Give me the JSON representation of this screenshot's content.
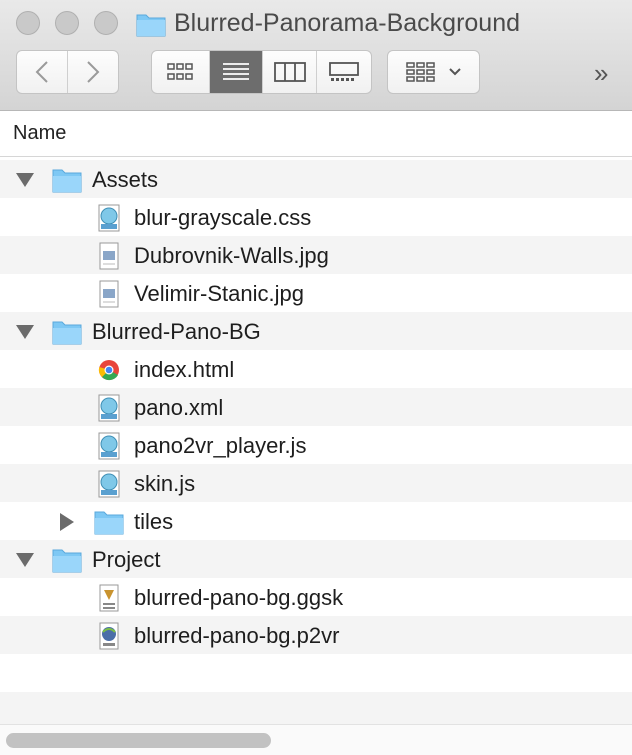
{
  "window": {
    "title": "Blurred-Panorama-Background"
  },
  "toolbar": {
    "back": "back",
    "forward": "forward",
    "overflow": "»"
  },
  "header": {
    "name_column": "Name"
  },
  "rows": [
    {
      "label": "Assets",
      "type": "folder",
      "expanded": true,
      "depth": 0
    },
    {
      "label": "blur-grayscale.css",
      "type": "text-file",
      "depth": 1
    },
    {
      "label": "Dubrovnik-Walls.jpg",
      "type": "image-file",
      "depth": 1
    },
    {
      "label": "Velimir-Stanic.jpg",
      "type": "image-file",
      "depth": 1
    },
    {
      "label": "Blurred-Pano-BG",
      "type": "folder",
      "expanded": true,
      "depth": 0
    },
    {
      "label": "index.html",
      "type": "chrome-file",
      "depth": 1
    },
    {
      "label": "pano.xml",
      "type": "text-file",
      "depth": 1
    },
    {
      "label": "pano2vr_player.js",
      "type": "text-file",
      "depth": 1
    },
    {
      "label": "skin.js",
      "type": "text-file",
      "depth": 1
    },
    {
      "label": "tiles",
      "type": "folder",
      "expanded": false,
      "depth": 1
    },
    {
      "label": "Project",
      "type": "folder",
      "expanded": true,
      "depth": 0
    },
    {
      "label": "blurred-pano-bg.ggsk",
      "type": "skin-file",
      "depth": 1
    },
    {
      "label": "blurred-pano-bg.p2vr",
      "type": "p2vr-file",
      "depth": 1
    }
  ],
  "colors": {
    "folder": "#7ec8f4",
    "active_segment": "#6d6d6d"
  }
}
